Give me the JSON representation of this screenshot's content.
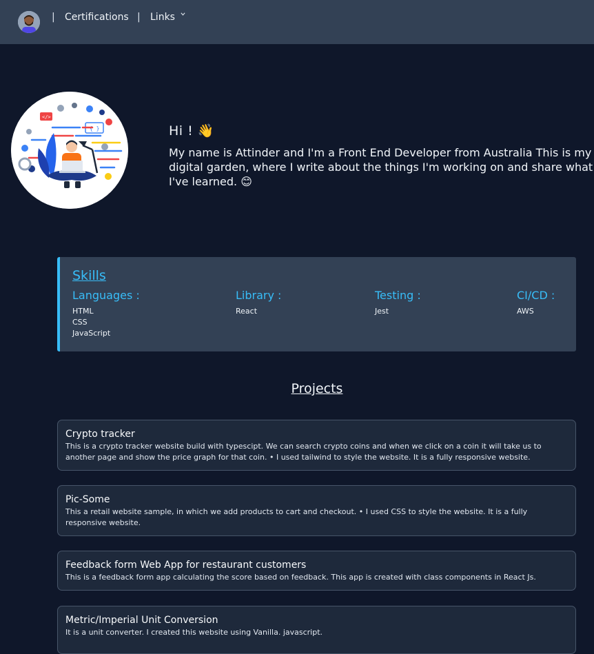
{
  "nav": {
    "separator": "|",
    "certifications": "Certifications",
    "links": "Links"
  },
  "hero": {
    "greeting": "Hi ! 👋",
    "intro": "My name is Attinder and I'm a Front End Developer from Australia This is my digital garden, where I write about the things I'm working on and share what I've learned. 😊"
  },
  "skills": {
    "title": "Skills",
    "columns": [
      {
        "heading": "Languages :",
        "items": [
          "HTML",
          "CSS",
          "JavaScript"
        ]
      },
      {
        "heading": "Library :",
        "items": [
          "React"
        ]
      },
      {
        "heading": "Testing :",
        "items": [
          "Jest"
        ]
      },
      {
        "heading": "CI/CD :",
        "items": [
          "AWS"
        ]
      }
    ]
  },
  "projects": {
    "title": "Projects",
    "items": [
      {
        "title": "Crypto tracker",
        "description": "This is a crypto tracker website build with typescipt. We can search crypto coins and when we click on a coin it will take us to another page and show the price graph for that coin. • I used tailwind to style the website. It is a fully responsive website."
      },
      {
        "title": "Pic-Some",
        "description": "This a retail website sample, in which we add products to cart and checkout. • I used CSS to style the website. It is a fully responsive website."
      },
      {
        "title": "Feedback form Web App for restaurant customers",
        "description": "This is a feedback form app calculating the score based on feedback. This app is created with class components in React Js."
      },
      {
        "title": "Metric/Imperial Unit Conversion",
        "description": "It is a unit converter. I created this website using Vanilla. javascript."
      }
    ]
  },
  "colors": {
    "accent": "#38bdf8",
    "background": "#0f172a",
    "nav": "#334155",
    "card": "#1e293b"
  },
  "icons": {
    "links_dropdown": "chevron-down-icon"
  }
}
